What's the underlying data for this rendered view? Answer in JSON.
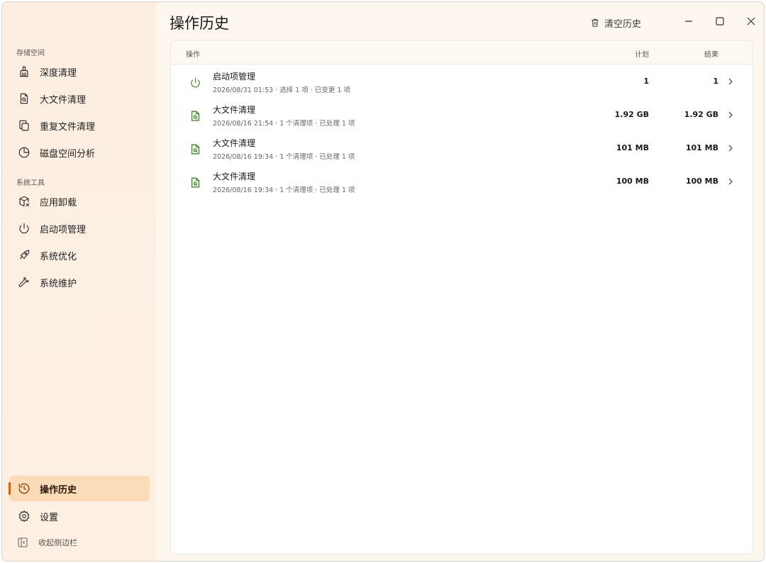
{
  "sidebar": {
    "section_storage": "存储空间",
    "section_tools": "系统工具",
    "items": [
      {
        "label": "深度清理",
        "icon": "broom-icon"
      },
      {
        "label": "大文件清理",
        "icon": "file-search-icon"
      },
      {
        "label": "重复文件清理",
        "icon": "copy-icon"
      },
      {
        "label": "磁盘空间分析",
        "icon": "pie-chart-icon"
      },
      {
        "label": "应用卸载",
        "icon": "package-remove-icon"
      },
      {
        "label": "启动项管理",
        "icon": "power-icon"
      },
      {
        "label": "系统优化",
        "icon": "rocket-icon"
      },
      {
        "label": "系统维护",
        "icon": "wrench-icon"
      }
    ],
    "history": {
      "label": "操作历史",
      "icon": "history-icon"
    },
    "settings": {
      "label": "设置",
      "icon": "gear-icon"
    },
    "collapse": {
      "label": "收起侧边栏",
      "icon": "collapse-sidebar-icon"
    }
  },
  "header": {
    "title": "操作历史",
    "clear_label": "清空历史"
  },
  "table": {
    "col_action": "操作",
    "col_plan": "计划",
    "col_result": "结果",
    "rows": [
      {
        "icon": "power-icon",
        "title": "启动项管理",
        "sub": "2026/08/31 01:53 · 选择 1 项 · 已变更 1 项",
        "plan": "1",
        "result": "1"
      },
      {
        "icon": "file-search-icon",
        "title": "大文件清理",
        "sub": "2026/08/16 21:54 · 1 个清理项 · 已处理 1 项",
        "plan": "1.92 GB",
        "result": "1.92 GB"
      },
      {
        "icon": "file-search-icon",
        "title": "大文件清理",
        "sub": "2026/08/16 19:34 · 1 个清理项 · 已处理 1 项",
        "plan": "101 MB",
        "result": "101 MB"
      },
      {
        "icon": "file-search-icon",
        "title": "大文件清理",
        "sub": "2026/08/16 19:34 · 1 个清理项 · 已处理 1 项",
        "plan": "100 MB",
        "result": "100 MB"
      }
    ]
  },
  "colors": {
    "accent": "#c8671c",
    "active_bg": "#fbdcb8",
    "green_icon": "#3f7a2f"
  }
}
